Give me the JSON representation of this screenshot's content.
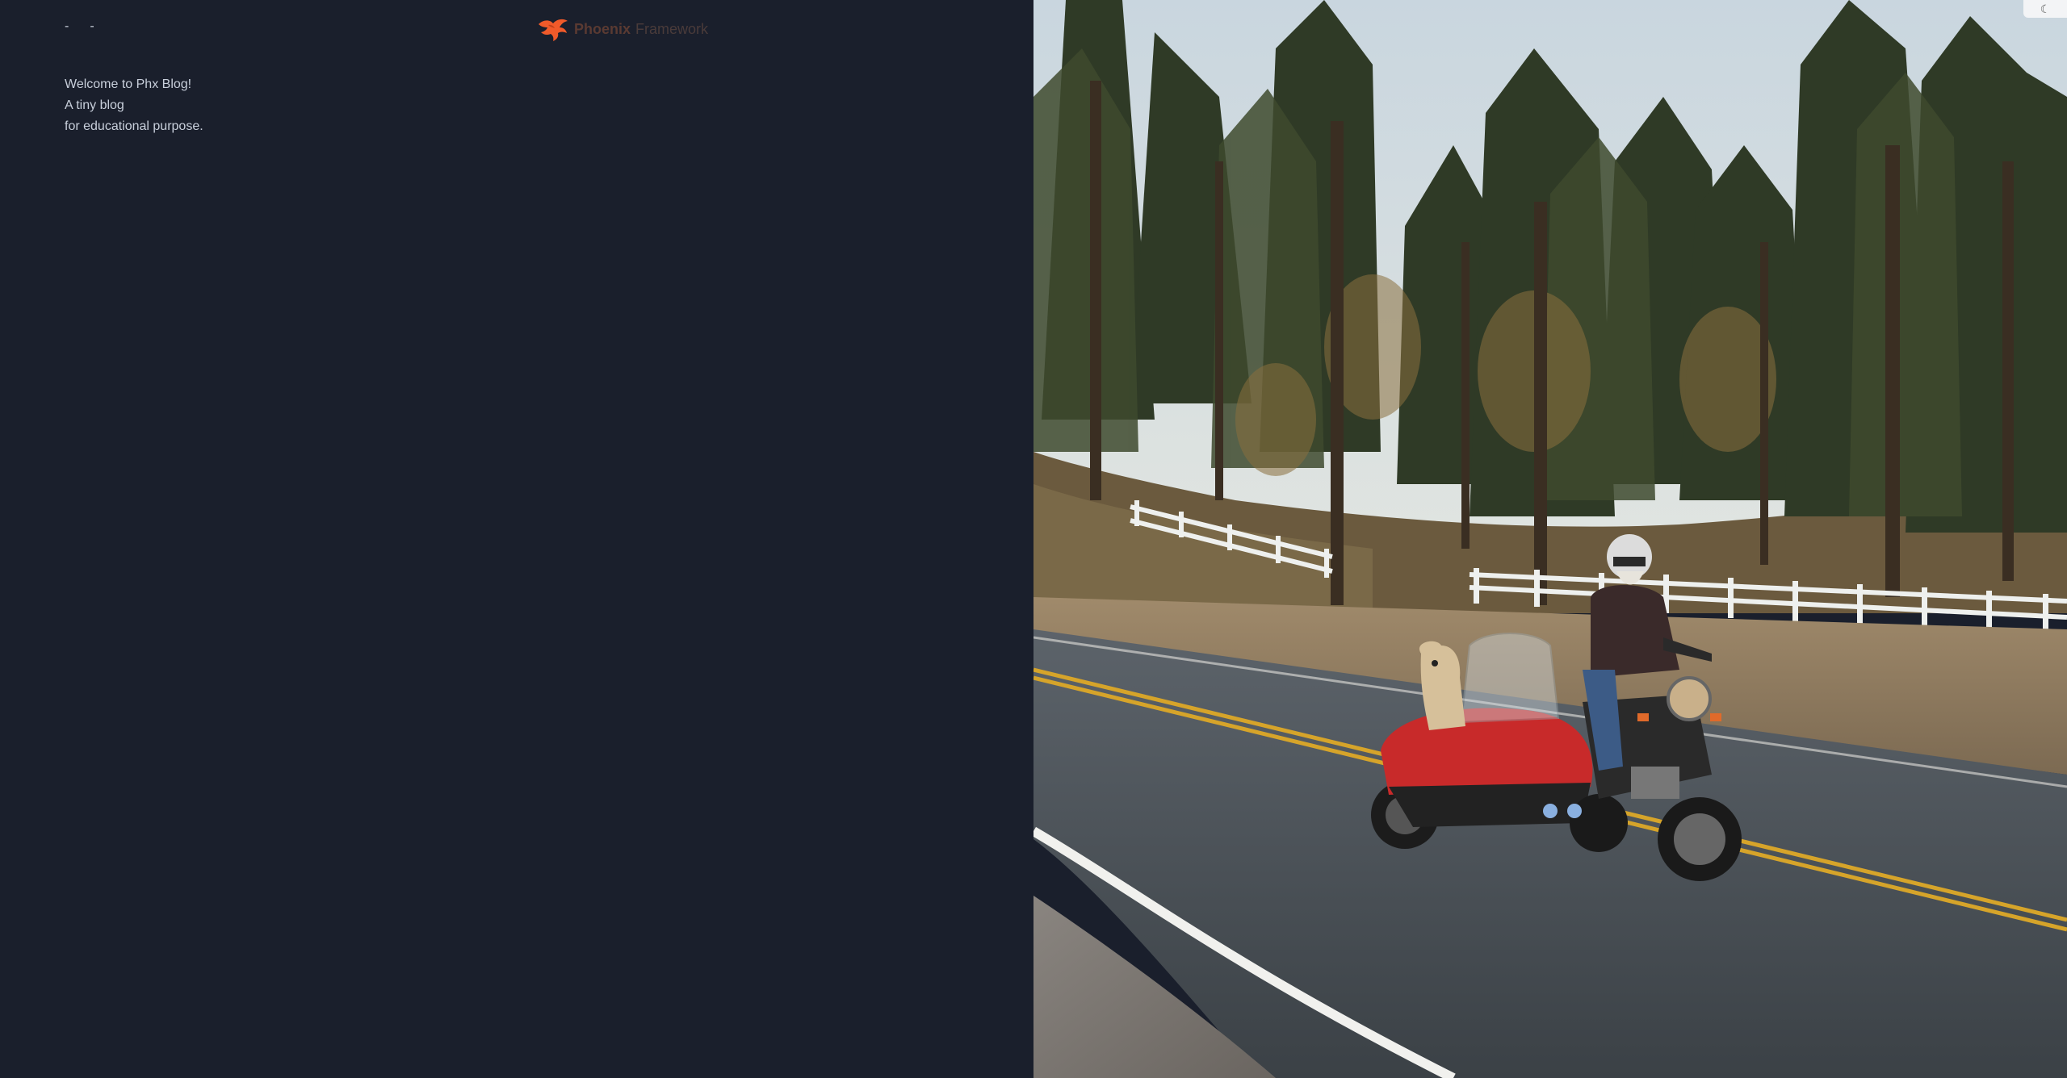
{
  "nav": {
    "link1": "-",
    "link2": "-"
  },
  "brand": {
    "name_bold": "Phoenix",
    "name_light": "Framework",
    "logo_icon": "phoenix-bird-icon",
    "color": "#f05a2a"
  },
  "intro": {
    "line1": "Welcome to Phx Blog!",
    "line2": "A tiny blog",
    "line3": "for educational purpose."
  },
  "hero": {
    "description_icon": "motorcycle-sidecar-photo"
  },
  "theme_toggle": {
    "icon": "moon-icon",
    "label": "☾"
  }
}
